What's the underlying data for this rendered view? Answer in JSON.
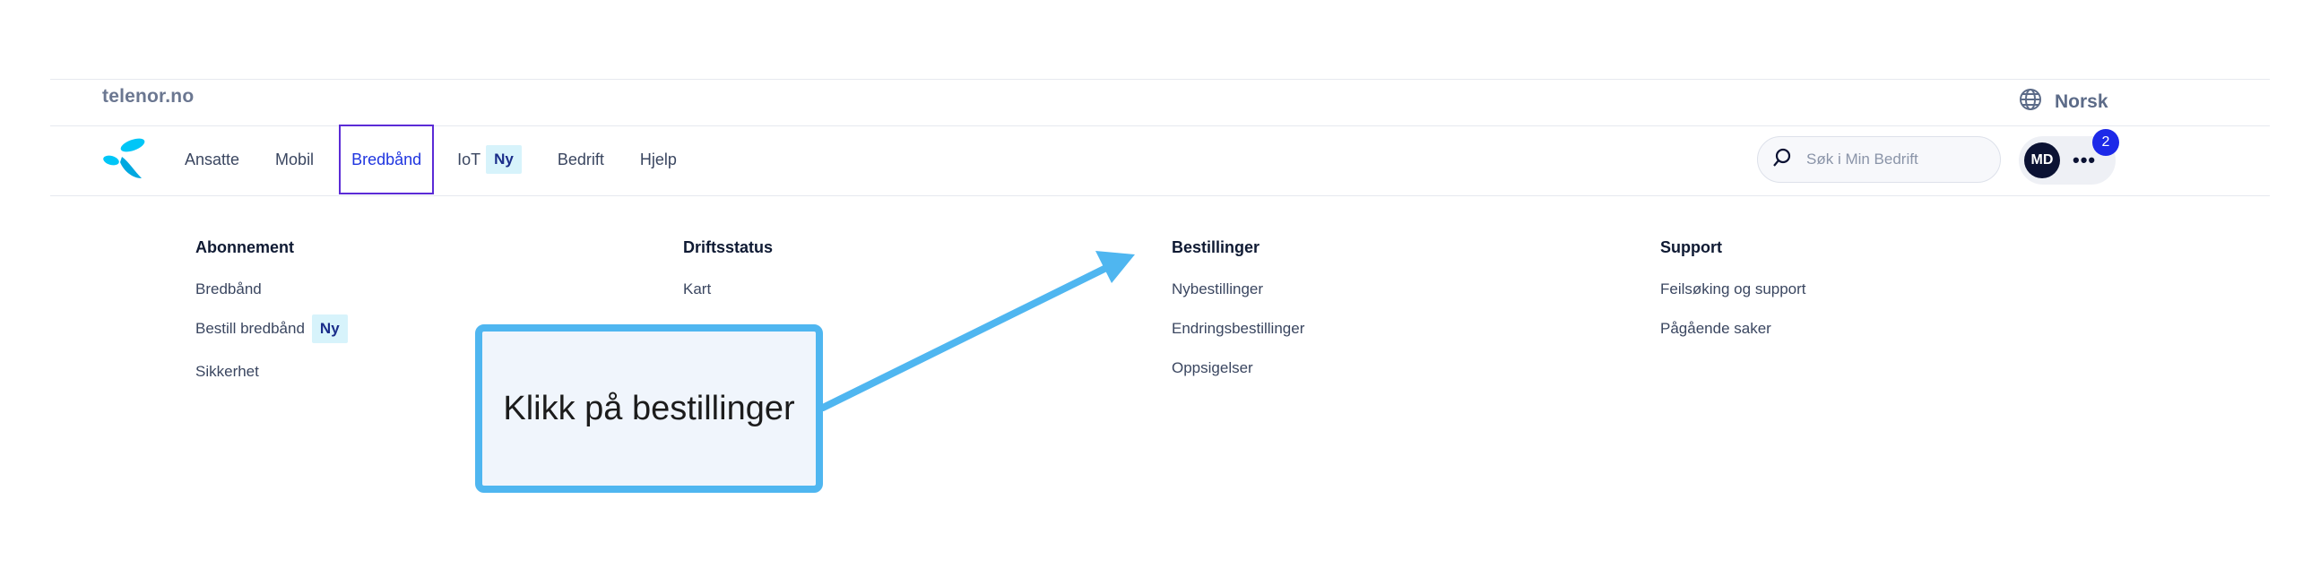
{
  "topbar": {
    "site": "telenor.no",
    "language": "Norsk",
    "language_icon": "globe-icon"
  },
  "nav": {
    "logo_icon": "telenor-logo-icon",
    "items": [
      {
        "label": "Ansatte"
      },
      {
        "label": "Mobil"
      },
      {
        "label": "Bredbånd",
        "active": true
      },
      {
        "label": "IoT",
        "badge": "Ny"
      },
      {
        "label": "Bedrift"
      },
      {
        "label": "Hjelp"
      }
    ]
  },
  "search": {
    "placeholder": "Søk i Min Bedrift",
    "icon": "search-icon"
  },
  "profile": {
    "initials": "MD",
    "more_icon": "more-dots-icon",
    "notification_count": "2"
  },
  "menu": {
    "columns": [
      {
        "heading": "Abonnement",
        "links": [
          {
            "label": "Bredbånd"
          },
          {
            "label": "Bestill bredbånd",
            "badge": "Ny"
          },
          {
            "label": "Sikkerhet"
          }
        ]
      },
      {
        "heading": "Driftsstatus",
        "links": [
          {
            "label": "Kart"
          }
        ]
      },
      {
        "heading": "Bestillinger",
        "links": [
          {
            "label": "Nybestillinger"
          },
          {
            "label": "Endringsbestillinger"
          },
          {
            "label": "Oppsigelser"
          }
        ]
      },
      {
        "heading": "Support",
        "links": [
          {
            "label": "Feilsøking og support"
          },
          {
            "label": "Pågående saker"
          }
        ]
      }
    ]
  },
  "annotation": {
    "text": "Klikk på bestillinger",
    "color": "#4fb6f0"
  },
  "colors": {
    "active_nav": "#1f35e0",
    "badge_bg": "#d7f3fb",
    "notification": "#1d29e8"
  }
}
